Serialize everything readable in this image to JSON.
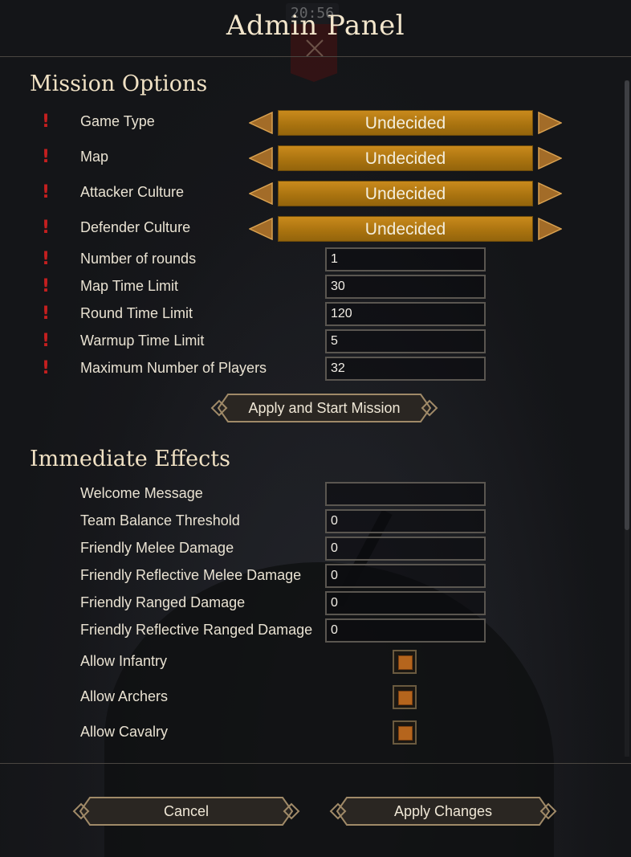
{
  "background": {
    "clock": "20:56"
  },
  "window": {
    "title": "Admin Panel"
  },
  "mission_options": {
    "heading": "Mission Options",
    "selectors": [
      {
        "label": "Game Type",
        "value": "Undecided"
      },
      {
        "label": "Map",
        "value": "Undecided"
      },
      {
        "label": "Attacker Culture",
        "value": "Undecided"
      },
      {
        "label": "Defender Culture",
        "value": "Undecided"
      }
    ],
    "fields": [
      {
        "label": "Number of rounds",
        "value": "1"
      },
      {
        "label": "Map Time Limit",
        "value": "30"
      },
      {
        "label": "Round Time Limit",
        "value": "120"
      },
      {
        "label": "Warmup Time Limit",
        "value": "5"
      },
      {
        "label": "Maximum Number of Players",
        "value": "32"
      }
    ],
    "apply_start_label": "Apply and Start Mission"
  },
  "immediate_effects": {
    "heading": "Immediate Effects",
    "fields": [
      {
        "label": "Welcome Message",
        "value": ""
      },
      {
        "label": "Team Balance Threshold",
        "value": "0"
      },
      {
        "label": "Friendly Melee Damage",
        "value": "0"
      },
      {
        "label": "Friendly Reflective Melee Damage",
        "value": "0"
      },
      {
        "label": "Friendly Ranged Damage",
        "value": "0"
      },
      {
        "label": "Friendly Reflective Ranged Damage",
        "value": "0"
      }
    ],
    "toggles": [
      {
        "label": "Allow Infantry",
        "checked": true
      },
      {
        "label": "Allow Archers",
        "checked": true
      },
      {
        "label": "Allow Cavalry",
        "checked": true
      }
    ]
  },
  "footer": {
    "cancel_label": "Cancel",
    "apply_label": "Apply Changes"
  },
  "colors": {
    "accent": "#c98a1c",
    "warning": "#c51f1f",
    "checkbox_fill": "#b5651d",
    "button_border": "#a08a68"
  }
}
